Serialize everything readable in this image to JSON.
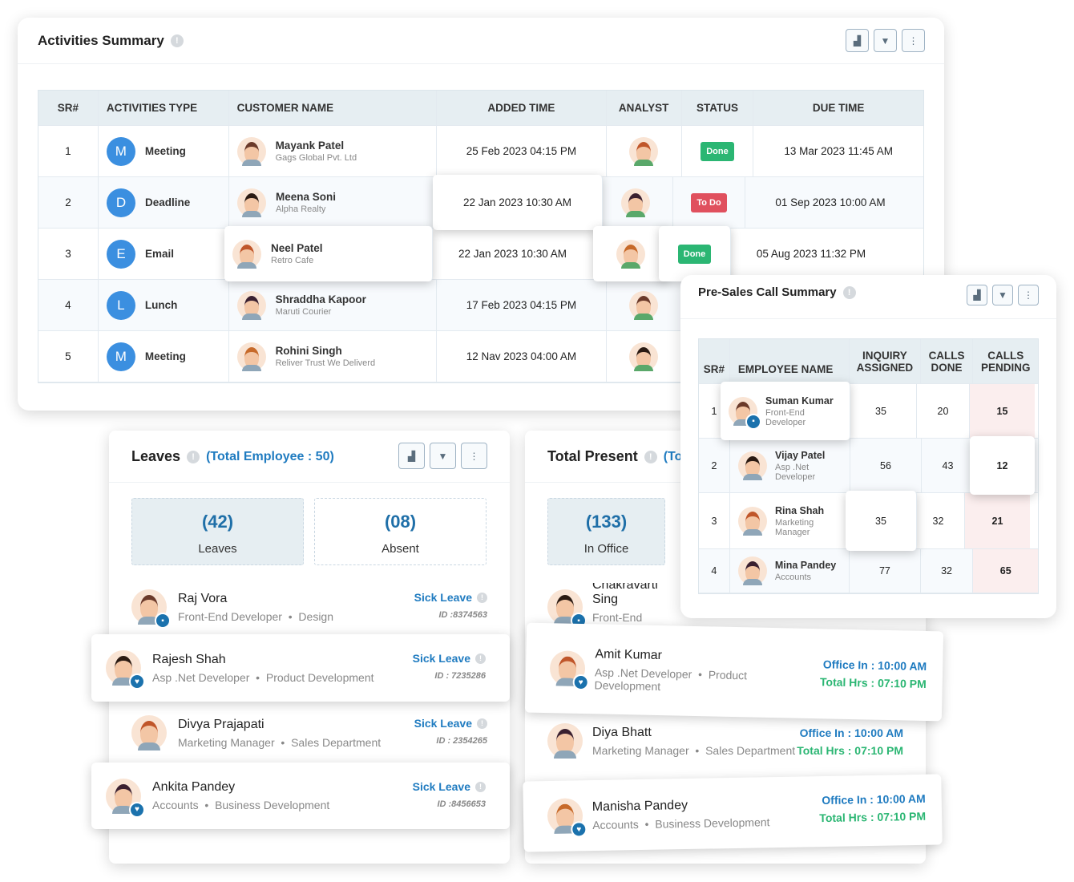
{
  "colors": {
    "accent": "#1f7bc0",
    "done": "#2bb673",
    "todo": "#e0505e",
    "pending_bg": "#fbeeee",
    "header_bg": "#e6eef2"
  },
  "activities": {
    "title": "Activities Summary",
    "tools": [
      "chart-icon",
      "filter-icon",
      "more-icon"
    ],
    "columns": [
      "SR#",
      "ACTIVITIES TYPE",
      "CUSTOMER NAME",
      "ADDED TIME",
      "ANALYST",
      "STATUS",
      "DUE TIME"
    ],
    "rows": [
      {
        "sr": "1",
        "letter": "M",
        "type": "Meeting",
        "customer": "Mayank Patel",
        "company": "Gags Global Pvt. Ltd",
        "added": "25 Feb 2023 04:15 PM",
        "status": "Done",
        "due": "13 Mar 2023 11:45 AM"
      },
      {
        "sr": "2",
        "letter": "D",
        "type": "Deadline",
        "customer": "Meena Soni",
        "company": "Alpha Realty",
        "added": "22 Jan 2023 10:30 AM",
        "status": "To Do",
        "due": "01 Sep 2023 10:00 AM"
      },
      {
        "sr": "3",
        "letter": "E",
        "type": "Email",
        "customer": "Neel Patel",
        "company": "Retro Cafe",
        "added": "22 Jan 2023 10:30 AM",
        "status": "Done",
        "due": "05 Aug 2023 11:32 PM"
      },
      {
        "sr": "4",
        "letter": "L",
        "type": "Lunch",
        "customer": "Shraddha Kapoor",
        "company": "Maruti Courier",
        "added": "17 Feb 2023 04:15 PM",
        "status": "",
        "due": ""
      },
      {
        "sr": "5",
        "letter": "M",
        "type": "Meeting",
        "customer": "Rohini Singh",
        "company": "Reliver Trust We Deliverd",
        "added": "12 Nav 2023 04:00 AM",
        "status": "",
        "due": ""
      }
    ]
  },
  "presales": {
    "title": "Pre-Sales Call Summary",
    "columns": [
      "SR#",
      "EMPLOYEE NAME",
      "INQUIRY ASSIGNED",
      "CALLS DONE",
      "CALLS PENDING"
    ],
    "rows": [
      {
        "sr": "1",
        "name": "Suman Kumar",
        "role": "Front-End Developer",
        "inquiry": "35",
        "done": "20",
        "pending": "15"
      },
      {
        "sr": "2",
        "name": "Vijay Patel",
        "role": "Asp .Net Developer",
        "inquiry": "56",
        "done": "43",
        "pending": "12"
      },
      {
        "sr": "3",
        "name": "Rina Shah",
        "role": "Marketing Manager",
        "inquiry": "35",
        "done": "32",
        "pending": "21"
      },
      {
        "sr": "4",
        "name": "Mina Pandey",
        "role": "Accounts",
        "inquiry": "77",
        "done": "32",
        "pending": "65"
      }
    ]
  },
  "leaves": {
    "title": "Leaves",
    "total": "(Total Employee : 50)",
    "stats": [
      {
        "value": "(42)",
        "label": "Leaves"
      },
      {
        "value": "(08)",
        "label": "Absent"
      }
    ],
    "items": [
      {
        "name": "Raj Vora",
        "role": "Front-End Developer",
        "dept": "Design",
        "type": "Sick Leave",
        "id": "ID :8374563"
      },
      {
        "name": "Rajesh Shah",
        "role": "Asp .Net Developer",
        "dept": "Product Development",
        "type": "Sick Leave",
        "id": "ID : 7235286"
      },
      {
        "name": "Divya Prajapati",
        "role": "Marketing Manager",
        "dept": "Sales Department",
        "type": "Sick Leave",
        "id": "ID : 2354265"
      },
      {
        "name": "Ankita Pandey",
        "role": "Accounts",
        "dept": "Business Development",
        "type": "Sick Leave",
        "id": "ID :8456653"
      }
    ]
  },
  "present": {
    "title": "Total Present",
    "total_partial": "(To",
    "stats": [
      {
        "value": "(133)",
        "label": "In Office"
      }
    ],
    "items": [
      {
        "name": "Chakravarti Sing",
        "role": "Front-End Develop",
        "dept": "",
        "office_in": "",
        "total_hrs": ""
      },
      {
        "name": "Amit Kumar",
        "role": "Asp .Net Developer",
        "dept": "Product Development",
        "office_in": "Office In : 10:00 AM",
        "total_hrs": "Total Hrs : 07:10 PM"
      },
      {
        "name": "Diya Bhatt",
        "role": "Marketing Manager",
        "dept": "Sales Department",
        "office_in": "Office In : 10:00 AM",
        "total_hrs": "Total Hrs : 07:10 PM"
      },
      {
        "name": "Manisha Pandey",
        "role": "Accounts",
        "dept": "Business Development",
        "office_in": "Office In : 10:00 AM",
        "total_hrs": "Total Hrs : 07:10 PM"
      }
    ]
  }
}
